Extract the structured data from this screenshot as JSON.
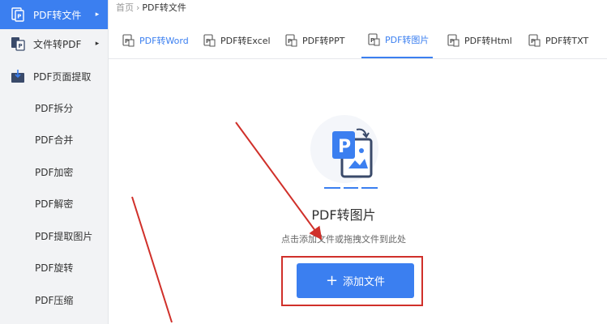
{
  "sidebar": {
    "items": [
      {
        "label": "PDF转文件",
        "icon": "pdf-convert-icon",
        "active": true
      },
      {
        "label": "文件转PDF",
        "icon": "file-to-pdf-icon",
        "active": false
      },
      {
        "label": "PDF页面提取",
        "icon": "page-extract-icon",
        "active": false
      },
      {
        "label": "PDF拆分"
      },
      {
        "label": "PDF合并"
      },
      {
        "label": "PDF加密"
      },
      {
        "label": "PDF解密"
      },
      {
        "label": "PDF提取图片"
      },
      {
        "label": "PDF旋转"
      },
      {
        "label": "PDF压缩"
      }
    ],
    "arrow": "▸"
  },
  "breadcrumb": {
    "home": "首页",
    "separator": "›",
    "current": "PDF转文件"
  },
  "tabs": [
    {
      "label": "PDF转Word",
      "icon": "word-doc-icon",
      "active": false
    },
    {
      "label": "PDF转Excel",
      "icon": "excel-doc-icon",
      "active": false
    },
    {
      "label": "PDF转PPT",
      "icon": "ppt-doc-icon",
      "active": false
    },
    {
      "label": "PDF转图片",
      "icon": "image-doc-icon",
      "active": true
    },
    {
      "label": "PDF转Html",
      "icon": "html-doc-icon",
      "active": false
    },
    {
      "label": "PDF转TXT",
      "icon": "txt-doc-icon",
      "active": false
    }
  ],
  "dropzone": {
    "title": "PDF转图片",
    "hint": "点击添加文件或拖拽文件到此处",
    "button_plus": "+",
    "button_label": "添加文件",
    "icon": "pdf-to-image-icon"
  },
  "colors": {
    "accent": "#3b7ff0",
    "annotation": "#d0302a",
    "sidebar_bg": "#f2f3f5"
  }
}
